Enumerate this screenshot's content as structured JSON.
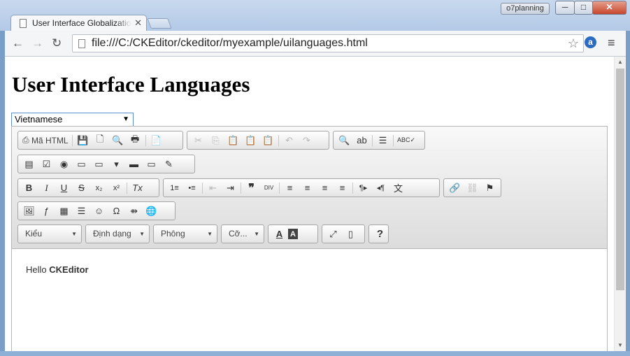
{
  "window": {
    "profile_badge": "o7planning",
    "minimize_glyph": "─",
    "maximize_glyph": "□",
    "close_glyph": "✕"
  },
  "tab": {
    "title": "User Interface Globalizatio",
    "close_glyph": "✕"
  },
  "navbar": {
    "back_glyph": "←",
    "forward_glyph": "→",
    "reload_glyph": "↻",
    "url": "file:///C:/CKEditor/ckeditor/myexample/uilanguages.html",
    "bookmark_glyph": "☆",
    "extension_letter": "a",
    "menu_glyph": "≡"
  },
  "page": {
    "title": "User Interface Languages",
    "language_select": {
      "selected": "Vietnamese",
      "caret": "▼"
    }
  },
  "editor": {
    "source_button": "Mã HTML",
    "styles_combo": "Kiểu",
    "format_combo": "Định dạng",
    "font_combo": "Phông",
    "size_combo": "Cỡ...",
    "help_glyph": "?",
    "content_prefix": "Hello ",
    "content_bold": "CKEditor",
    "icons": {
      "save": "💾",
      "new_page": "🗋",
      "preview": "🔍",
      "print": "🖶",
      "templates": "📄",
      "cut": "✂",
      "copy": "⎘",
      "paste": "📋",
      "paste_text": "📋",
      "paste_word": "📋",
      "undo": "↶",
      "redo": "↷",
      "find": "🔍",
      "replace": "ab",
      "select_all": "☰",
      "spellcheck": "ABC✓",
      "form": "▤",
      "checkbox": "☑",
      "radio": "◉",
      "textfield": "▭",
      "textarea": "▭",
      "select": "▾",
      "button": "▬",
      "imagebutton": "▭",
      "hiddenfield": "✎",
      "bold": "B",
      "italic": "I",
      "underline": "U",
      "strike": "S",
      "subscript": "x₂",
      "superscript": "x²",
      "remove_format": "Tx",
      "numbered_list": "1≡",
      "bulleted_list": "•≡",
      "outdent": "⇤",
      "indent": "⇥",
      "blockquote": "❞",
      "div": "DIV",
      "align_left": "≡",
      "align_center": "≡",
      "align_right": "≡",
      "justify": "≡",
      "ltr": "¶▸",
      "rtl": "◂¶",
      "language": "文",
      "link": "🔗",
      "unlink": "⛓",
      "anchor": "⚑",
      "image": "🖼",
      "flash": "ƒ",
      "table": "▦",
      "hline": "☰",
      "smiley": "☺",
      "special_char": "Ω",
      "pagebreak": "⇻",
      "iframe": "🌐",
      "text_color": "A",
      "bg_color": "A",
      "maximize": "⤢",
      "show_blocks": "▯"
    }
  }
}
